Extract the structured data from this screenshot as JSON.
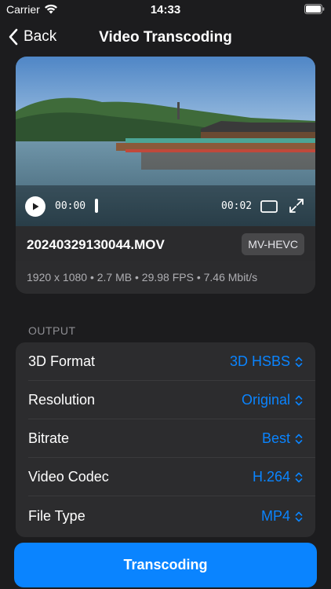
{
  "status_bar": {
    "carrier": "Carrier",
    "time": "14:33"
  },
  "nav": {
    "back_label": "Back",
    "title": "Video Transcoding"
  },
  "player": {
    "current_time": "00:00",
    "total_time": "00:02",
    "progress": 0.0
  },
  "file": {
    "name": "20240329130044.MOV",
    "badge": "MV-HEVC",
    "meta": "1920 x 1080  •  2.7 MB  •  29.98 FPS  •  7.46 Mbit/s"
  },
  "output": {
    "header": "OUTPUT",
    "rows": [
      {
        "label": "3D Format",
        "value": "3D HSBS"
      },
      {
        "label": "Resolution",
        "value": "Original"
      },
      {
        "label": "Bitrate",
        "value": "Best"
      },
      {
        "label": "Video Codec",
        "value": "H.264"
      },
      {
        "label": "File Type",
        "value": "MP4"
      }
    ]
  },
  "primary_button": {
    "label": "Transcoding"
  },
  "colors": {
    "accent": "#0a84ff",
    "background": "#1c1c1e",
    "card": "#2c2c2e"
  }
}
